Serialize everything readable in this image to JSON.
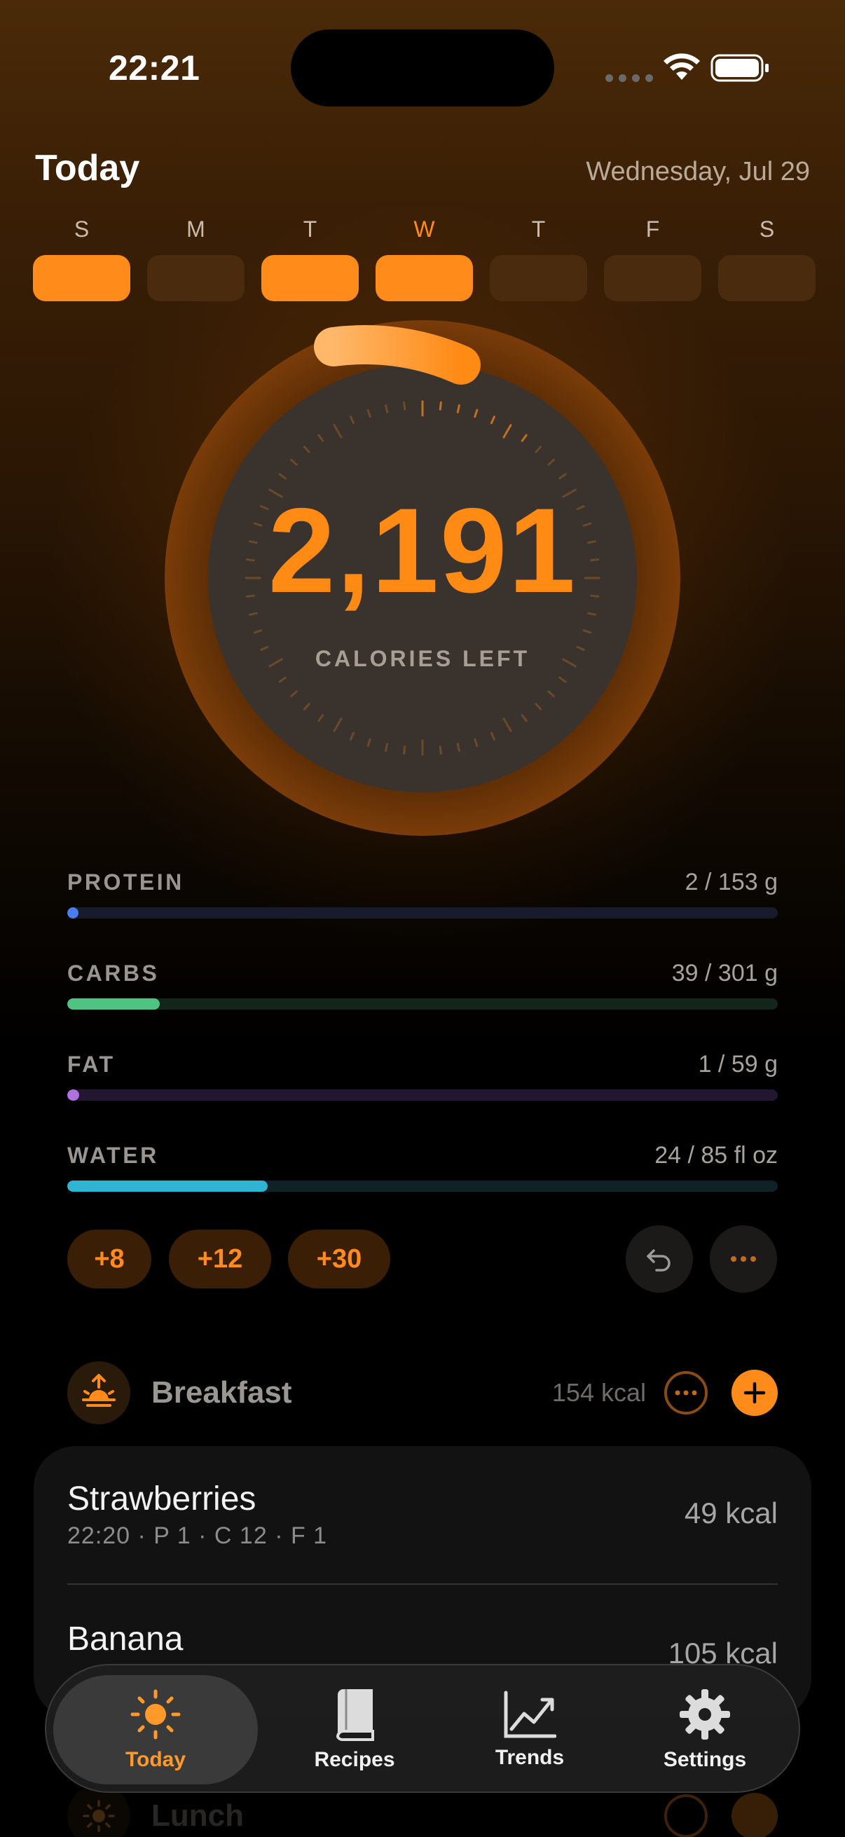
{
  "status_bar": {
    "time": "22:21"
  },
  "header": {
    "title": "Today",
    "date": "Wednesday, Jul 29"
  },
  "week": {
    "days": [
      {
        "letter": "S",
        "filled": true
      },
      {
        "letter": "M",
        "filled": false
      },
      {
        "letter": "T",
        "filled": true
      },
      {
        "letter": "W",
        "filled": true,
        "selected": true
      },
      {
        "letter": "T",
        "filled": false
      },
      {
        "letter": "F",
        "filled": false
      },
      {
        "letter": "S",
        "filled": false
      }
    ]
  },
  "calories": {
    "value": "2,191",
    "label": "CALORIES LEFT"
  },
  "macros": [
    {
      "name": "PROTEIN",
      "value": "2 / 153 g",
      "fraction": 0.013,
      "color": "#4a7df0",
      "track": "#161c2c"
    },
    {
      "name": "CARBS",
      "value": "39 / 301 g",
      "fraction": 0.13,
      "color": "#4fc480",
      "track": "#12261b"
    },
    {
      "name": "FAT",
      "value": "1 / 59 g",
      "fraction": 0.017,
      "color": "#b070e0",
      "track": "#231631"
    },
    {
      "name": "WATER",
      "value": "24 / 85 fl oz",
      "fraction": 0.282,
      "color": "#2fb4d4",
      "track": "#0f2228"
    }
  ],
  "water_buttons": [
    "+8",
    "+12",
    "+30"
  ],
  "meals": {
    "breakfast": {
      "title": "Breakfast",
      "kcal": "154 kcal",
      "items": [
        {
          "name": "Strawberries",
          "meta": "22:20 · P 1 · C 12 · F 1",
          "kcal": "49 kcal"
        },
        {
          "name": "Banana",
          "meta": "",
          "kcal": "105 kcal"
        }
      ]
    },
    "lunch": {
      "title": "Lunch"
    }
  },
  "tabs": [
    {
      "label": "Today",
      "icon": "sun-icon",
      "active": true
    },
    {
      "label": "Recipes",
      "icon": "book-icon",
      "active": false
    },
    {
      "label": "Trends",
      "icon": "chart-icon",
      "active": false
    },
    {
      "label": "Settings",
      "icon": "gear-icon",
      "active": false
    }
  ],
  "colors": {
    "accent": "#ff8c1a",
    "background": "#000000"
  }
}
